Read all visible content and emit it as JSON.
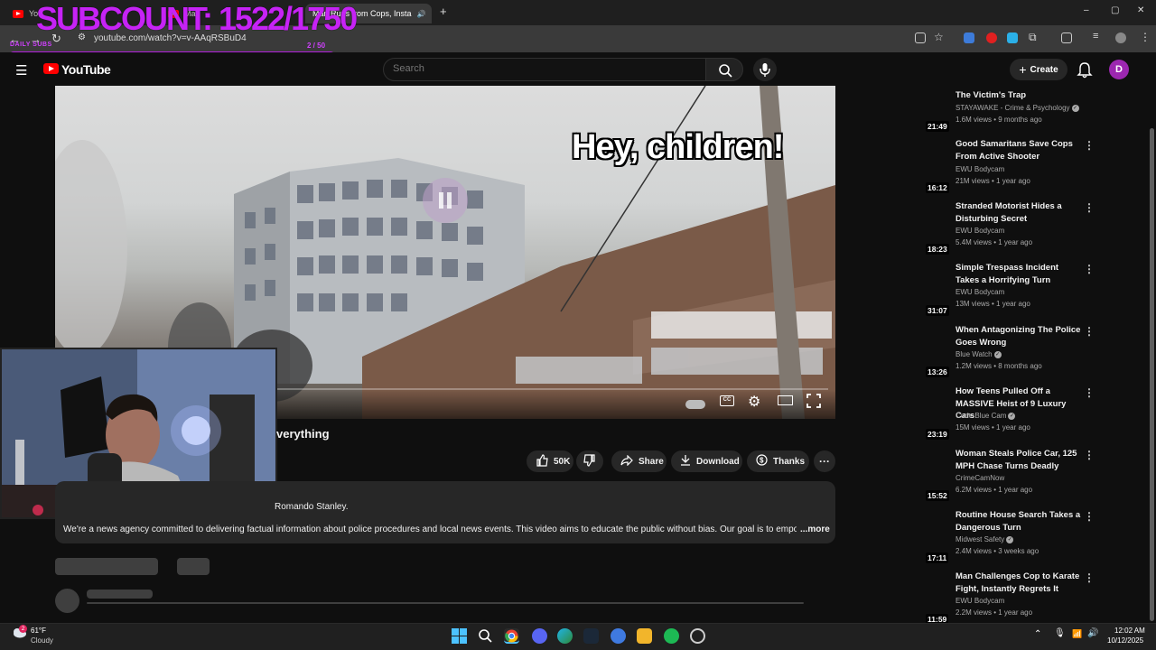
{
  "browser": {
    "tabs": [
      {
        "label": "Yo",
        "active": false
      },
      {
        "label": "Ma",
        "active": false
      },
      {
        "label": "Man Runs from Cops, Insta",
        "active": true
      }
    ],
    "new_tab": "+",
    "url": "youtube.com/watch?v=v-AAqRSBuD4",
    "window_controls": [
      "–",
      "▢",
      "✕"
    ]
  },
  "overlay": {
    "subcount": "SUBCOUNT: 1522/1750",
    "goal_label": "DAILY SUBS",
    "goal_count": "2 / 50",
    "goal_progress": 0.04
  },
  "youtube": {
    "logo_text": "YouTube",
    "search_placeholder": "Search",
    "create_label": "Create",
    "avatar_letter": "D"
  },
  "video": {
    "caption": "Hey, children!",
    "title_visible": "verything",
    "likes": "50K",
    "share_label": "Share",
    "download_label": "Download",
    "thanks_label": "Thanks",
    "more_label": "···",
    "desc_line1": "Romando Stanley.",
    "desc_line2": "We're a news agency committed to delivering factual information about police procedures and local news events. This video aims to educate the public without bias. Our goal is to empower viewers",
    "desc_more": "...more"
  },
  "recommendations": [
    {
      "title": "The Victim's Trap",
      "channel": "STAYAWAKE - Crime & Psychology",
      "verified": true,
      "meta": "1.6M views • 9 months ago",
      "duration": "21:49"
    },
    {
      "title": "Good Samaritans Save Cops From Active Shooter",
      "channel": "EWU Bodycam",
      "verified": false,
      "meta": "21M views • 1 year ago",
      "duration": "16:12"
    },
    {
      "title": "Stranded Motorist Hides a Disturbing Secret",
      "channel": "EWU Bodycam",
      "verified": false,
      "meta": "5.4M views • 1 year ago",
      "duration": "18:23"
    },
    {
      "title": "Simple Trespass Incident Takes a Horrifying Turn",
      "channel": "EWU Bodycam",
      "verified": false,
      "meta": "13M views • 1 year ago",
      "duration": "31:07"
    },
    {
      "title": "When Antagonizing The Police Goes Wrong",
      "channel": "Blue Watch",
      "verified": true,
      "meta": "1.2M views • 8 months ago",
      "duration": "13:26"
    },
    {
      "title": "How Teens Pulled Off a MASSIVE Heist of 9 Luxury Cars",
      "channel": "Code Blue Cam",
      "verified": true,
      "meta": "15M views • 1 year ago",
      "duration": "23:19"
    },
    {
      "title": "Woman Steals Police Car, 125 MPH Chase Turns Deadly",
      "channel": "CrimeCamNow",
      "verified": false,
      "meta": "6.2M views • 1 year ago",
      "duration": "15:52"
    },
    {
      "title": "Routine House Search Takes a Dangerous Turn",
      "channel": "Midwest Safety",
      "verified": true,
      "meta": "2.4M views • 3 weeks ago",
      "duration": "17:11"
    },
    {
      "title": "Man Challenges Cop to Karate Fight, Instantly Regrets It",
      "channel": "EWU Bodycam",
      "verified": false,
      "meta": "2.2M views • 1 year ago",
      "duration": "11:59"
    }
  ],
  "taskbar": {
    "weather_temp": "61°F",
    "weather_desc": "Cloudy",
    "weather_badge": "2",
    "time": "12:02 AM",
    "date": "10/12/2025"
  },
  "colors": {
    "accent": "#c623f5",
    "youtube_red": "#ff0000",
    "avatar": "#9c27b0"
  }
}
